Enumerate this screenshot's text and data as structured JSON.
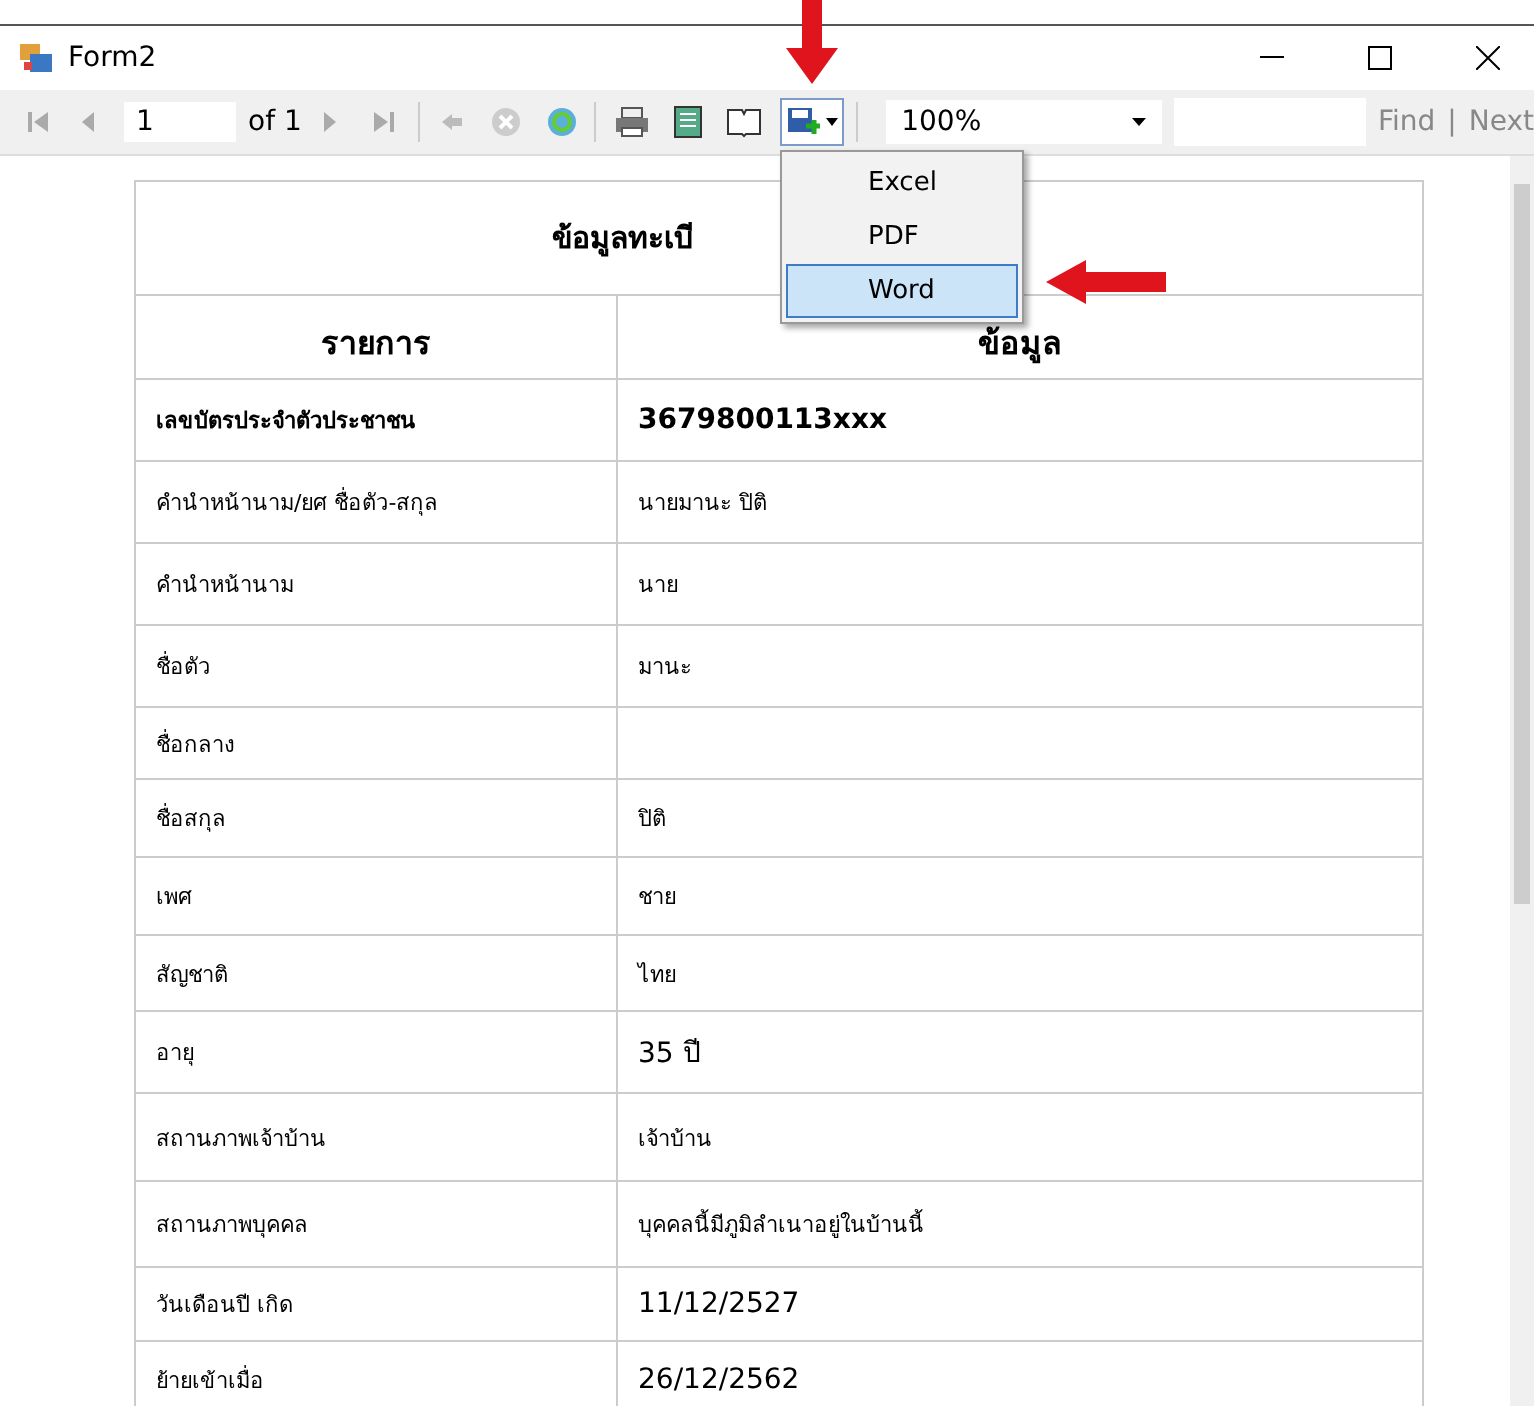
{
  "window": {
    "title": "Form2"
  },
  "toolbar": {
    "page": "1",
    "page_count": "of 1",
    "zoom": "100%",
    "find_label": "Find",
    "separator": "|",
    "next_label": "Next"
  },
  "export_menu": {
    "items": [
      {
        "label": "Excel",
        "selected": false
      },
      {
        "label": "PDF",
        "selected": false
      },
      {
        "label": "Word",
        "selected": true
      }
    ]
  },
  "report": {
    "title": "ข้อมูลทะเบี",
    "columns": [
      "รายการ",
      "ข้อมูล"
    ],
    "rows": [
      {
        "label": "เลขบัตรประจำตัวประชาชน",
        "value": "3679800113xxx",
        "bold": true
      },
      {
        "label": "คำนำหน้านาม/ยศ ชื่อตัว-สกุล",
        "value": "นายมานะ ปิติ",
        "bold": false
      },
      {
        "label": "คำนำหน้านาม",
        "value": "นาย",
        "bold": false
      },
      {
        "label": "ชื่อตัว",
        "value": "มานะ",
        "bold": false
      },
      {
        "label": "ชื่อกลาง",
        "value": "",
        "bold": false
      },
      {
        "label": "ชื่อสกุล",
        "value": "ปิติ",
        "bold": false
      },
      {
        "label": "เพศ",
        "value": "ชาย",
        "bold": false
      },
      {
        "label": "สัญชาติ",
        "value": "ไทย",
        "bold": false
      },
      {
        "label": "อายุ",
        "value": "35 ปี",
        "bold": false
      },
      {
        "label": "สถานภาพเจ้าบ้าน",
        "value": "เจ้าบ้าน",
        "bold": false
      },
      {
        "label": "สถานภาพบุคคล",
        "value": "บุคคลนี้มีภูมิลำเนาอยู่ในบ้านนี้",
        "bold": false
      },
      {
        "label": "วันเดือนปี เกิด",
        "value": "11/12/2527",
        "bold": false
      },
      {
        "label": "ย้ายเข้าเมื่อ",
        "value": "26/12/2562",
        "bold": false
      }
    ]
  }
}
